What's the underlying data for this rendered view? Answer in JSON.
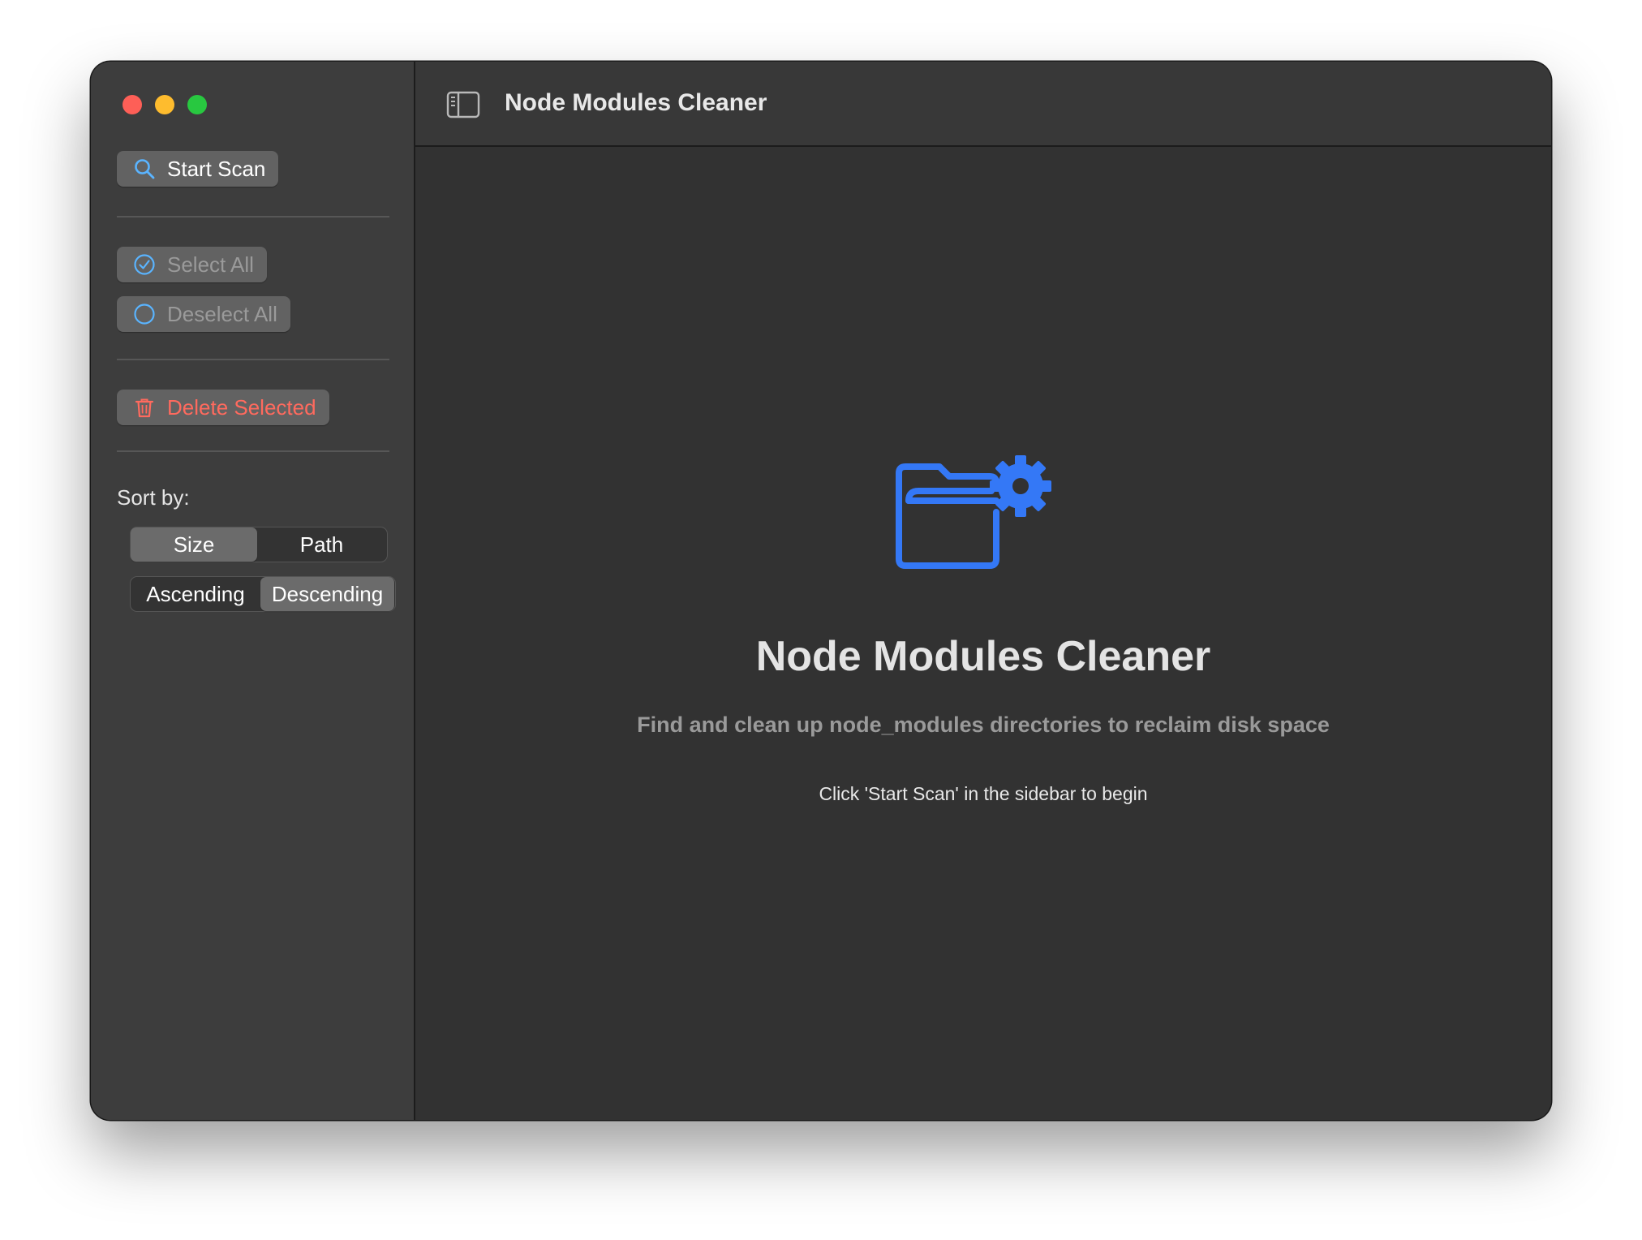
{
  "window": {
    "title": "Node Modules Cleaner"
  },
  "sidebar": {
    "start_scan": {
      "label": "Start Scan",
      "icon": "magnifier-icon"
    },
    "select_all": {
      "label": "Select All",
      "icon": "checkmark-circle-icon"
    },
    "deselect_all": {
      "label": "Deselect All",
      "icon": "circle-icon"
    },
    "delete_selected": {
      "label": "Delete Selected",
      "icon": "trash-icon"
    },
    "sort_label": "Sort by:",
    "sort_field": {
      "options": [
        "Size",
        "Path"
      ],
      "selected": "Size"
    },
    "sort_order": {
      "options": [
        "Ascending",
        "Descending"
      ],
      "selected": "Descending"
    }
  },
  "main": {
    "icon": "folder-gear-icon",
    "title": "Node Modules Cleaner",
    "subtitle": "Find and clean up node_modules directories to reclaim disk space",
    "hint": "Click 'Start Scan' in the sidebar to begin"
  },
  "colors": {
    "accent": "#3478f6",
    "icon_blue": "#5ab4ff",
    "danger": "#ff6a5e",
    "close": "#fe5f57",
    "minimize": "#febc2e",
    "maximize": "#28c840"
  }
}
